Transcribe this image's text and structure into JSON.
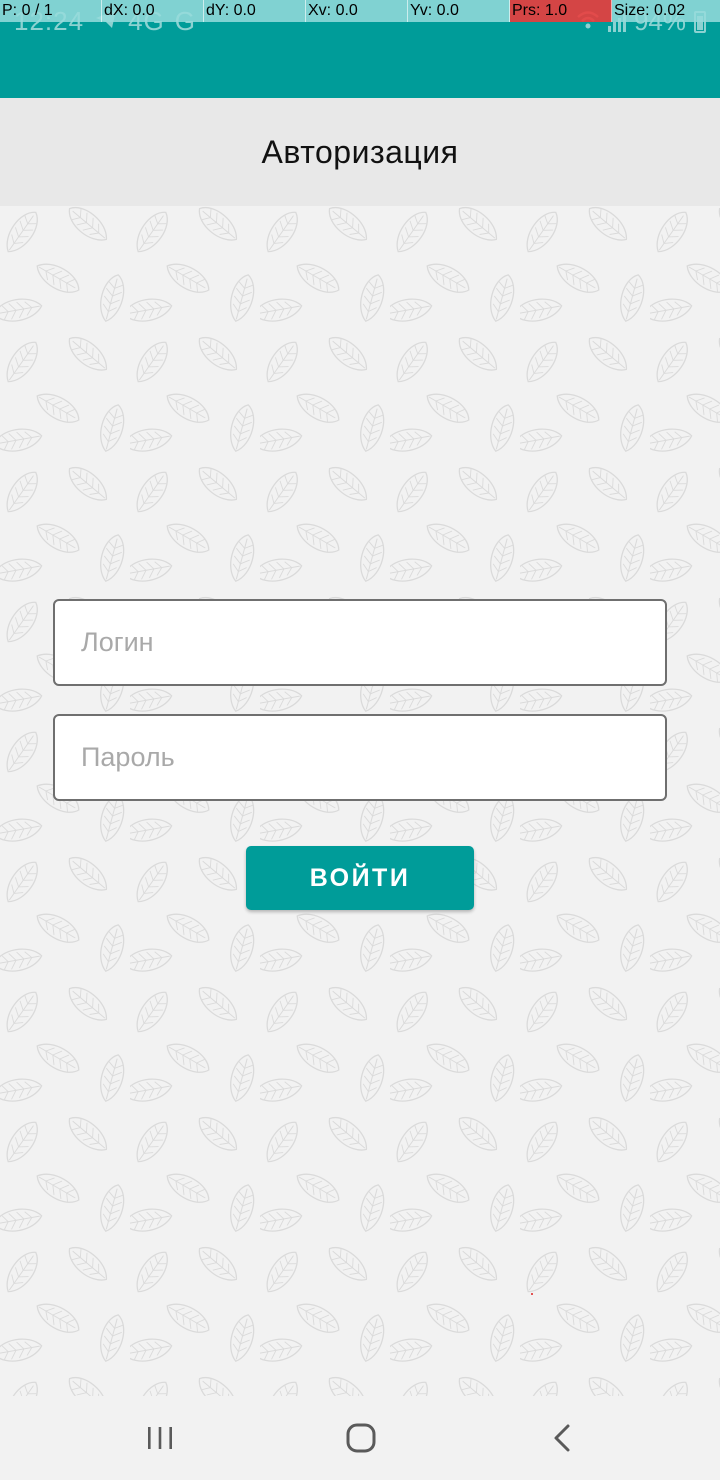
{
  "status_bar": {
    "time": "12:24",
    "network": "4G",
    "battery": "94%"
  },
  "debug_overlay": {
    "cells": [
      "P: 0 / 1",
      "dX: 0.0",
      "dY: 0.0",
      "Xv: 0.0",
      "Yv: 0.0",
      "Prs: 1.0",
      "Size: 0.02"
    ]
  },
  "header": {
    "title": "Авторизация"
  },
  "form": {
    "login_placeholder": "Логин",
    "login_value": "",
    "password_placeholder": "Пароль",
    "password_value": "",
    "submit_label": "ВОЙТИ"
  },
  "nav": {
    "recents": "recents-icon",
    "home": "home-icon",
    "back": "back-icon"
  },
  "colors": {
    "accent": "#009c99",
    "header_bg": "#e8e8e8",
    "page_bg": "#f2f2f2",
    "field_border": "#6f6f6f",
    "debug_bg": "#96dcdc",
    "debug_alert": "#eb3c3c"
  }
}
